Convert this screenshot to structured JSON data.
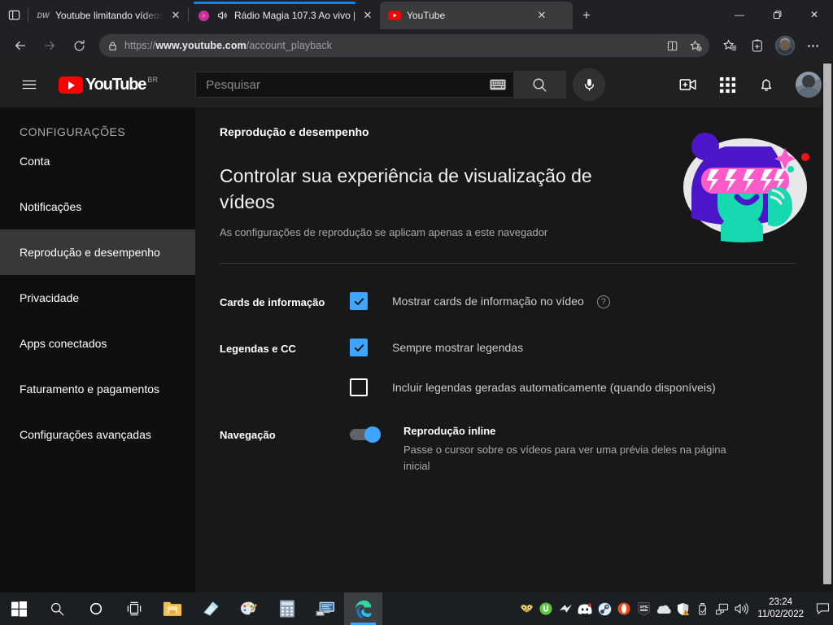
{
  "browser": {
    "tab_list_icon": "tab-list-icon",
    "tabs": [
      {
        "title": "Youtube limitando vídeos em qu",
        "favicon": "dw-icon",
        "state": "inactive",
        "close_label": "✕"
      },
      {
        "title": "Rádio Magia 107.3 Ao vivo |",
        "favicon": "play-circle-icon",
        "state": "loading",
        "audio": "speaker-icon",
        "close_label": "✕"
      },
      {
        "title": "YouTube",
        "favicon": "youtube-icon",
        "state": "active",
        "close_label": "✕"
      }
    ],
    "new_tab_label": "+",
    "window_controls": {
      "minimize": "—",
      "maximize": "❐",
      "close": "✕"
    },
    "nav": {
      "back": "←",
      "forward": "→",
      "reload": "↻"
    },
    "omnibox": {
      "lock_icon": "lock-icon",
      "url_scheme": "https://",
      "url_domain": "www.youtube.com",
      "url_path": "/account_playback",
      "split_screen_icon": "split-screen-icon",
      "add_favorite_icon": "add-favorite-icon"
    },
    "toolbar": {
      "favorites_icon": "favorites-icon",
      "collections_icon": "collections-icon",
      "profile_icon": "profile-avatar",
      "settings_icon": "more-options-icon"
    },
    "loading_accent": "#0a84ff"
  },
  "youtube": {
    "menu_icon": "hamburger-menu-icon",
    "logo": {
      "wordmark": "YouTube",
      "country": "BR",
      "color": "#ff0000"
    },
    "search": {
      "placeholder": "Pesquisar",
      "value": "",
      "keyboard_icon": "keyboard-icon",
      "search_icon": "search-icon",
      "mic_icon": "microphone-icon"
    },
    "header_icons": {
      "create": "create-video-icon",
      "apps": "apps-grid-icon",
      "notifications": "notifications-bell-icon",
      "avatar": "account-avatar"
    },
    "sidebar": {
      "heading": "CONFIGURAÇÕES",
      "items": [
        {
          "label": "Conta",
          "selected": false
        },
        {
          "label": "Notificações",
          "selected": false
        },
        {
          "label": "Reprodução e desempenho",
          "selected": true
        },
        {
          "label": "Privacidade",
          "selected": false
        },
        {
          "label": "Apps conectados",
          "selected": false
        },
        {
          "label": "Faturamento e pagamentos",
          "selected": false
        },
        {
          "label": "Configurações avançadas",
          "selected": false
        }
      ]
    },
    "main": {
      "section_label": "Reprodução e desempenho",
      "title": "Controlar sua experiência de visualização de vídeos",
      "subtitle": "As configurações de reprodução se aplicam apenas a este navegador",
      "illustration": "person-with-lightning-sunglasses-illustration",
      "settings": [
        {
          "label": "Cards de informação",
          "options": [
            {
              "type": "checkbox",
              "checked": true,
              "text": "Mostrar cards de informação no vídeo",
              "help": "?"
            }
          ]
        },
        {
          "label": "Legendas e CC",
          "options": [
            {
              "type": "checkbox",
              "checked": true,
              "text": "Sempre mostrar legendas"
            },
            {
              "type": "checkbox",
              "checked": false,
              "text": "Incluir legendas geradas automaticamente (quando disponíveis)"
            }
          ]
        },
        {
          "label": "Navegação",
          "options": [
            {
              "type": "toggle",
              "on": true,
              "title": "Reprodução inline",
              "description": "Passe o cursor sobre os vídeos para ver uma prévia deles na página inicial"
            }
          ]
        }
      ],
      "accent_color": "#3ea6ff"
    }
  },
  "taskbar": {
    "start_icon": "windows-start-icon",
    "search_icon": "taskbar-search-icon",
    "cortana_icon": "cortana-icon",
    "taskview_icon": "task-view-icon",
    "apps": [
      {
        "name": "file-explorer-icon"
      },
      {
        "name": "sticky-notes-icon"
      },
      {
        "name": "paint-icon"
      },
      {
        "name": "calculator-icon"
      },
      {
        "name": "remote-desktop-icon"
      },
      {
        "name": "microsoft-edge-icon",
        "active": true
      }
    ],
    "tray": [
      {
        "name": "owl-tray-icon"
      },
      {
        "name": "utorrent-tray-icon"
      },
      {
        "name": "arrow-tray-icon"
      },
      {
        "name": "discord-tray-icon"
      },
      {
        "name": "steam-tray-icon"
      },
      {
        "name": "opera-tray-icon"
      },
      {
        "name": "epic-games-tray-icon"
      },
      {
        "name": "onedrive-tray-icon"
      },
      {
        "name": "security-shield-warning-icon"
      },
      {
        "name": "usb-eject-icon"
      },
      {
        "name": "network-icon"
      },
      {
        "name": "volume-icon"
      }
    ],
    "clock": {
      "time": "23:24",
      "date": "11/02/2022"
    },
    "notification_icon": "notification-center-icon"
  }
}
